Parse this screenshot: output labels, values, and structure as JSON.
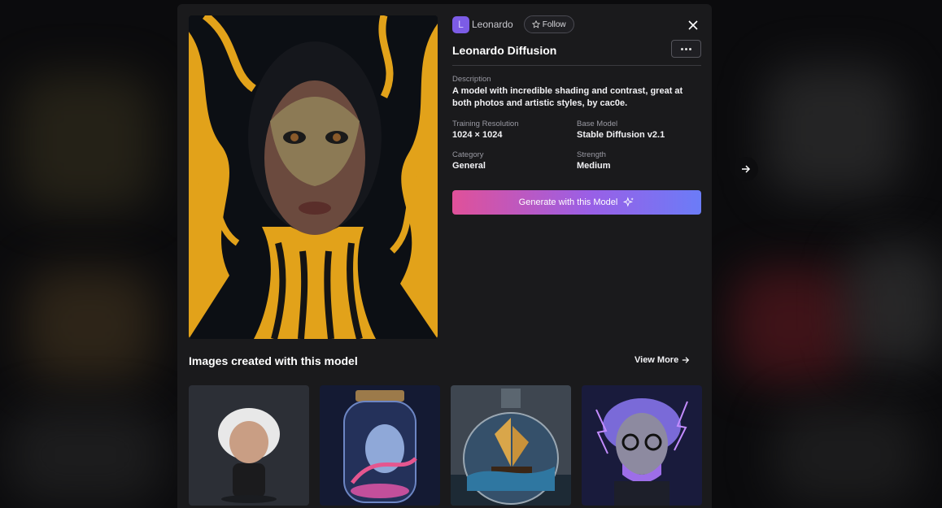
{
  "author": {
    "avatar_letter": "L",
    "name": "Leonardo",
    "follow_label": "Follow"
  },
  "model": {
    "title": "Leonardo Diffusion",
    "description_label": "Description",
    "description": "A model with incredible shading and contrast, great at both photos and artistic styles, by cac0e.",
    "training_resolution_label": "Training Resolution",
    "training_resolution": "1024 × 1024",
    "base_model_label": "Base Model",
    "base_model": "Stable Diffusion v2.1",
    "category_label": "Category",
    "category": "General",
    "strength_label": "Strength",
    "strength": "Medium"
  },
  "generate_button_label": "Generate with this Model",
  "gallery": {
    "title": "Images created with this model",
    "view_more_label": "View More",
    "thumbnails": [
      "einstein-figure",
      "cat-in-jar",
      "ship-in-bottle",
      "lightning-old-man"
    ]
  },
  "colors": {
    "accent_start": "#e05199",
    "accent_end": "#6b7cf7",
    "panel_bg": "#1a1a1c"
  }
}
